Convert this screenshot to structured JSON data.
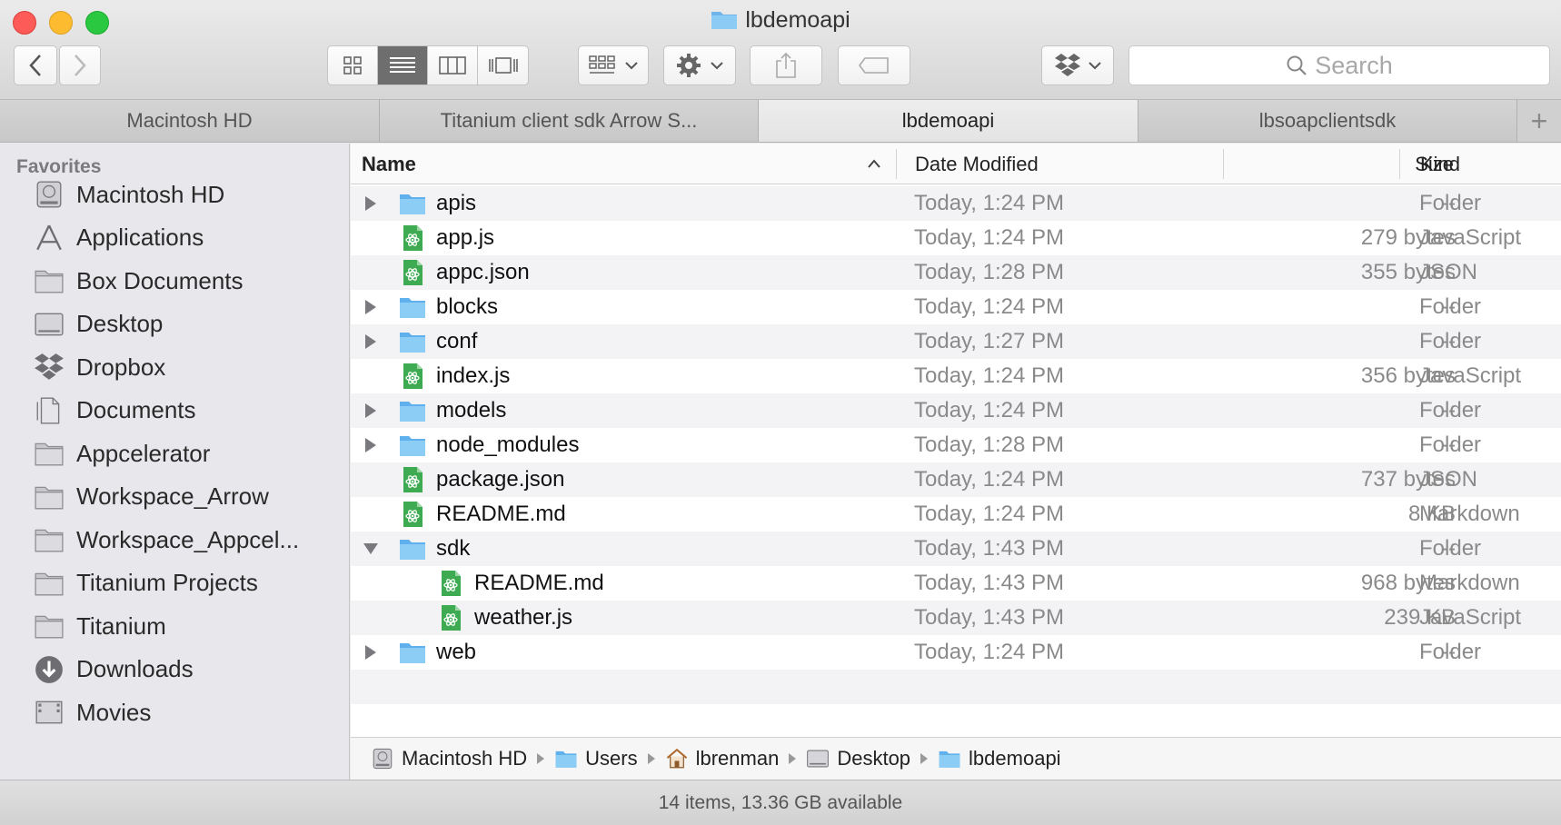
{
  "window": {
    "title": "lbdemoapi"
  },
  "toolbar": {
    "search_placeholder": "Search"
  },
  "tabs": [
    {
      "label": "Macintosh HD",
      "active": false
    },
    {
      "label": "Titanium client sdk Arrow S...",
      "active": false
    },
    {
      "label": "lbdemoapi",
      "active": true
    },
    {
      "label": "lbsoapclientsdk",
      "active": false
    }
  ],
  "sidebar": {
    "heading": "Favorites",
    "items": [
      {
        "label": "Macintosh HD",
        "icon": "hard-drive-icon"
      },
      {
        "label": "Applications",
        "icon": "applications-icon"
      },
      {
        "label": "Box Documents",
        "icon": "folder-icon"
      },
      {
        "label": "Desktop",
        "icon": "desktop-icon"
      },
      {
        "label": "Dropbox",
        "icon": "dropbox-icon"
      },
      {
        "label": "Documents",
        "icon": "documents-icon"
      },
      {
        "label": "Appcelerator",
        "icon": "folder-icon"
      },
      {
        "label": "Workspace_Arrow",
        "icon": "folder-icon"
      },
      {
        "label": "Workspace_Appcel...",
        "icon": "folder-icon"
      },
      {
        "label": "Titanium Projects",
        "icon": "folder-icon"
      },
      {
        "label": "Titanium",
        "icon": "folder-icon"
      },
      {
        "label": "Downloads",
        "icon": "downloads-icon"
      },
      {
        "label": "Movies",
        "icon": "movies-icon"
      }
    ]
  },
  "columns": {
    "name": "Name",
    "date": "Date Modified",
    "size": "Size",
    "kind": "Kind"
  },
  "files": [
    {
      "name": "apis",
      "date": "Today, 1:24 PM",
      "size": "--",
      "kind": "Folder",
      "type": "folder",
      "expanded": false,
      "depth": 0
    },
    {
      "name": "app.js",
      "date": "Today, 1:24 PM",
      "size": "279 bytes",
      "kind": "JavaScript",
      "type": "file",
      "depth": 0
    },
    {
      "name": "appc.json",
      "date": "Today, 1:28 PM",
      "size": "355 bytes",
      "kind": "JSON",
      "type": "file",
      "depth": 0
    },
    {
      "name": "blocks",
      "date": "Today, 1:24 PM",
      "size": "--",
      "kind": "Folder",
      "type": "folder",
      "expanded": false,
      "depth": 0
    },
    {
      "name": "conf",
      "date": "Today, 1:27 PM",
      "size": "--",
      "kind": "Folder",
      "type": "folder",
      "expanded": false,
      "depth": 0
    },
    {
      "name": "index.js",
      "date": "Today, 1:24 PM",
      "size": "356 bytes",
      "kind": "JavaScript",
      "type": "file",
      "depth": 0
    },
    {
      "name": "models",
      "date": "Today, 1:24 PM",
      "size": "--",
      "kind": "Folder",
      "type": "folder",
      "expanded": false,
      "depth": 0
    },
    {
      "name": "node_modules",
      "date": "Today, 1:28 PM",
      "size": "--",
      "kind": "Folder",
      "type": "folder",
      "expanded": false,
      "depth": 0
    },
    {
      "name": "package.json",
      "date": "Today, 1:24 PM",
      "size": "737 bytes",
      "kind": "JSON",
      "type": "file",
      "depth": 0
    },
    {
      "name": "README.md",
      "date": "Today, 1:24 PM",
      "size": "8 KB",
      "kind": "Markdown",
      "type": "file",
      "depth": 0
    },
    {
      "name": "sdk",
      "date": "Today, 1:43 PM",
      "size": "--",
      "kind": "Folder",
      "type": "folder",
      "expanded": true,
      "depth": 0
    },
    {
      "name": "README.md",
      "date": "Today, 1:43 PM",
      "size": "968 bytes",
      "kind": "Markdown",
      "type": "file",
      "depth": 1
    },
    {
      "name": "weather.js",
      "date": "Today, 1:43 PM",
      "size": "239 KB",
      "kind": "JavaScript",
      "type": "file",
      "depth": 1
    },
    {
      "name": "web",
      "date": "Today, 1:24 PM",
      "size": "--",
      "kind": "Folder",
      "type": "folder",
      "expanded": false,
      "depth": 0
    }
  ],
  "pathbar": [
    {
      "label": "Macintosh HD",
      "icon": "hard-drive-icon"
    },
    {
      "label": "Users",
      "icon": "folder-icon"
    },
    {
      "label": "lbrenman",
      "icon": "home-icon"
    },
    {
      "label": "Desktop",
      "icon": "desktop-icon"
    },
    {
      "label": "lbdemoapi",
      "icon": "folder-icon"
    }
  ],
  "status": {
    "text": "14 items, 13.36 GB available"
  }
}
